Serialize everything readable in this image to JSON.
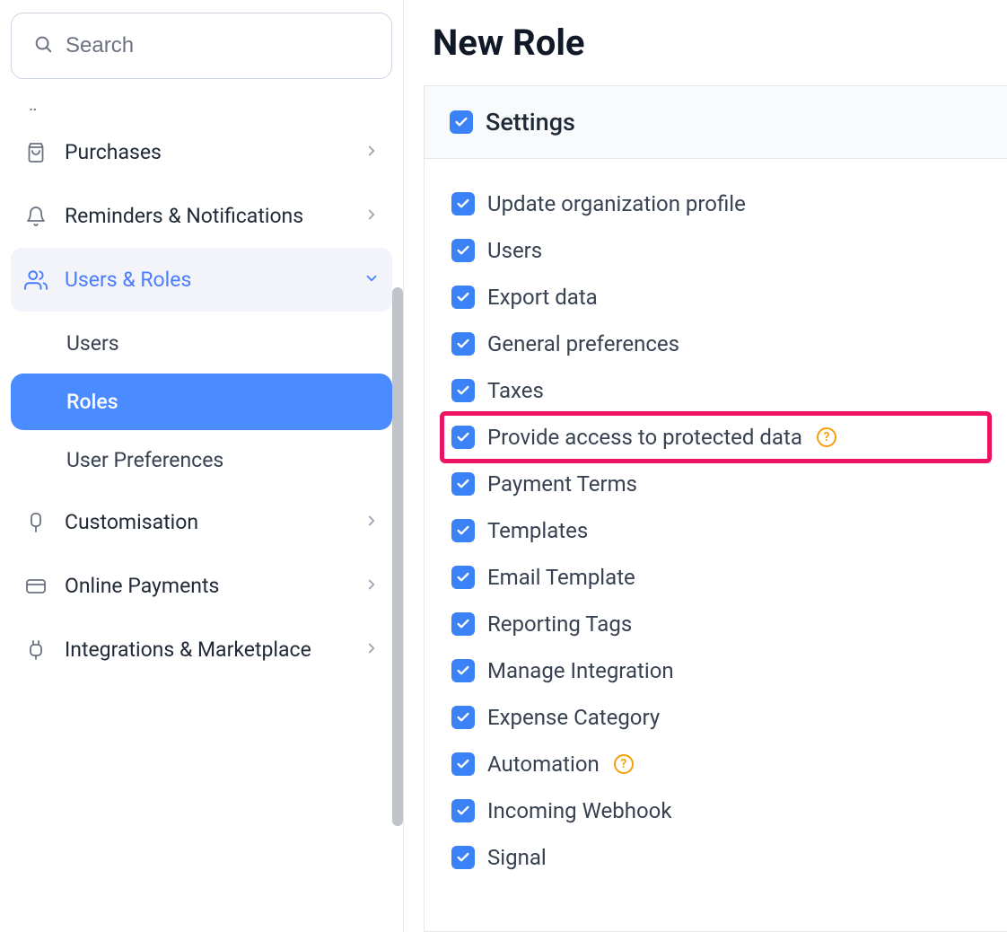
{
  "search": {
    "placeholder": "Search"
  },
  "sidebar": {
    "items": [
      {
        "label": "Purchases"
      },
      {
        "label": "Reminders & Notifications"
      },
      {
        "label": "Users & Roles"
      },
      {
        "label": "Customisation"
      },
      {
        "label": "Online Payments"
      },
      {
        "label": "Integrations & Marketplace"
      }
    ],
    "subnav": {
      "users": "Users",
      "roles": "Roles",
      "user_preferences": "User Preferences"
    }
  },
  "page_title": "New Role",
  "section_title": "Settings",
  "permissions": [
    {
      "label": "Update organization profile",
      "checked": true,
      "help": false,
      "highlight": false
    },
    {
      "label": "Users",
      "checked": true,
      "help": false,
      "highlight": false
    },
    {
      "label": "Export data",
      "checked": true,
      "help": false,
      "highlight": false
    },
    {
      "label": "General preferences",
      "checked": true,
      "help": false,
      "highlight": false
    },
    {
      "label": "Taxes",
      "checked": true,
      "help": false,
      "highlight": false
    },
    {
      "label": "Provide access to protected data",
      "checked": true,
      "help": true,
      "highlight": true
    },
    {
      "label": "Payment Terms",
      "checked": true,
      "help": false,
      "highlight": false
    },
    {
      "label": "Templates",
      "checked": true,
      "help": false,
      "highlight": false
    },
    {
      "label": "Email Template",
      "checked": true,
      "help": false,
      "highlight": false
    },
    {
      "label": "Reporting Tags",
      "checked": true,
      "help": false,
      "highlight": false
    },
    {
      "label": "Manage Integration",
      "checked": true,
      "help": false,
      "highlight": false
    },
    {
      "label": "Expense Category",
      "checked": true,
      "help": false,
      "highlight": false
    },
    {
      "label": "Automation",
      "checked": true,
      "help": true,
      "highlight": false
    },
    {
      "label": "Incoming Webhook",
      "checked": true,
      "help": false,
      "highlight": false
    },
    {
      "label": "Signal",
      "checked": true,
      "help": false,
      "highlight": false
    }
  ]
}
